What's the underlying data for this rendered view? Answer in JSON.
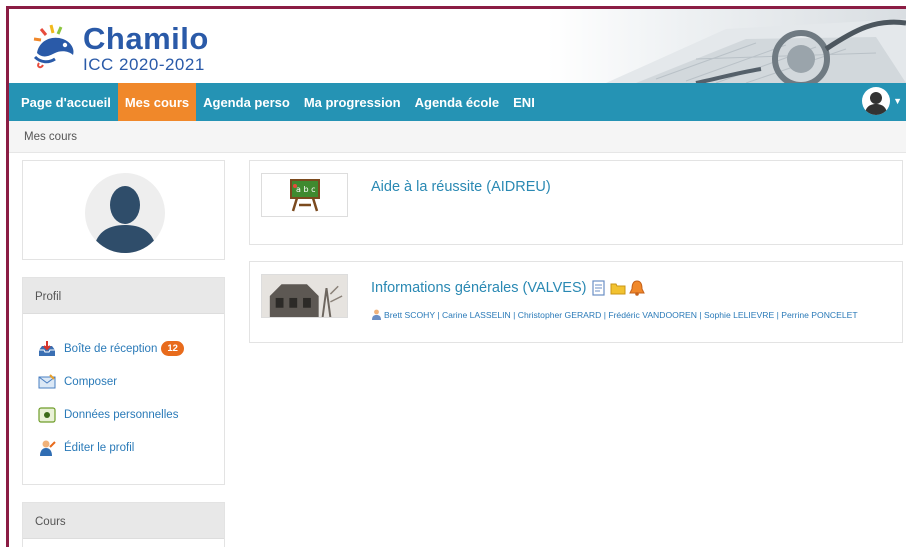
{
  "brand": {
    "name": "Chamilo",
    "subtitle": "ICC 2020-2021",
    "primary_color": "#2a5aa8",
    "nav_color": "#2593b4",
    "active_color": "#f0882a"
  },
  "nav": {
    "items": [
      {
        "label": "Page d'accueil"
      },
      {
        "label": "Mes cours"
      },
      {
        "label": "Agenda perso"
      },
      {
        "label": "Ma progression"
      },
      {
        "label": "Agenda école"
      },
      {
        "label": "ENI"
      }
    ],
    "active_index": 1,
    "user_icon": "user-avatar-icon"
  },
  "breadcrumb": "Mes cours",
  "sidebar": {
    "profile_heading": "Profil",
    "profile_items": [
      {
        "label": "Boîte de réception",
        "icon": "inbox-icon",
        "badge": "12"
      },
      {
        "label": "Composer",
        "icon": "envelope-icon"
      },
      {
        "label": "Données personnelles",
        "icon": "personal-data-icon"
      },
      {
        "label": "Éditer le profil",
        "icon": "edit-profile-icon"
      }
    ],
    "courses_heading": "Cours"
  },
  "courses": [
    {
      "title": "Aide à la réussite (AIDREU)",
      "thumbnail_icon": "chalkboard-icon"
    },
    {
      "title": "Informations générales (VALVES)",
      "thumbnail_icon": "building-photo",
      "status_icons": [
        "document-icon",
        "folder-icon",
        "bell-icon"
      ],
      "teachers": "Brett SCOHY | Carine LASSELIN | Christopher GERARD | Frédéric VANDOOREN | Sophie LELIEVRE | Perrine PONCELET"
    }
  ]
}
